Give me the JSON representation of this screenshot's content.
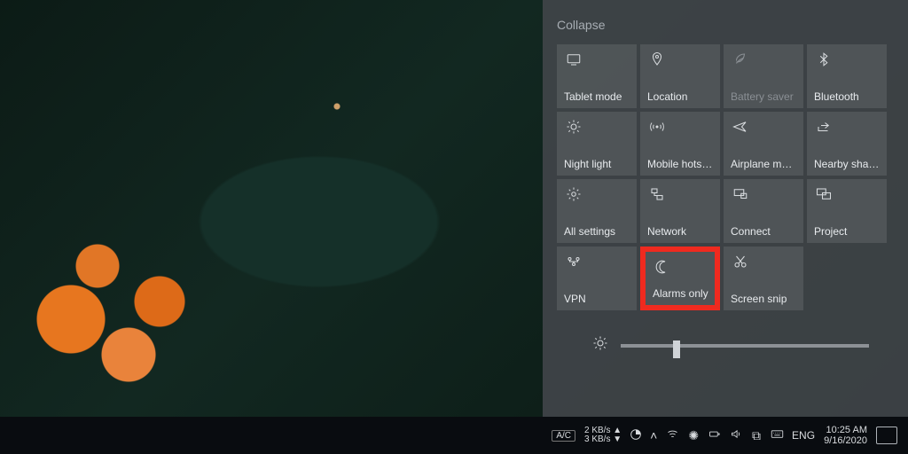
{
  "action_center": {
    "collapse_label": "Collapse",
    "tiles": [
      {
        "id": "tablet-mode",
        "label": "Tablet mode",
        "icon": "tablet-icon"
      },
      {
        "id": "location",
        "label": "Location",
        "icon": "location-icon"
      },
      {
        "id": "battery-saver",
        "label": "Battery saver",
        "icon": "leaf-icon",
        "disabled": true
      },
      {
        "id": "bluetooth",
        "label": "Bluetooth",
        "icon": "bluetooth-icon"
      },
      {
        "id": "night-light",
        "label": "Night light",
        "icon": "sun-icon"
      },
      {
        "id": "mobile-hotspot",
        "label": "Mobile hotspot",
        "icon": "hotspot-icon"
      },
      {
        "id": "airplane-mode",
        "label": "Airplane mode",
        "icon": "airplane-icon"
      },
      {
        "id": "nearby-sharing",
        "label": "Nearby sharing",
        "icon": "share-icon"
      },
      {
        "id": "all-settings",
        "label": "All settings",
        "icon": "gear-icon"
      },
      {
        "id": "network",
        "label": "Network",
        "icon": "network-icon"
      },
      {
        "id": "connect",
        "label": "Connect",
        "icon": "connect-icon"
      },
      {
        "id": "project",
        "label": "Project",
        "icon": "project-icon"
      },
      {
        "id": "vpn",
        "label": "VPN",
        "icon": "vpn-icon"
      },
      {
        "id": "alarms-only",
        "label": "Alarms only",
        "icon": "moon-icon",
        "highlighted": true
      },
      {
        "id": "screen-snip",
        "label": "Screen snip",
        "icon": "snip-icon"
      }
    ],
    "brightness_percent": 22
  },
  "taskbar": {
    "power_mode": "A/C",
    "net_up": "2 KB/s ▲",
    "net_down": "3 KB/s ▼",
    "language": "ENG",
    "time": "10:25 AM",
    "date": "9/16/2020",
    "tray_icons": [
      "chevron-up-icon",
      "wifi-icon",
      "brightness-icon",
      "plug-icon",
      "volume-icon",
      "dropbox-icon",
      "keyboard-icon"
    ]
  }
}
